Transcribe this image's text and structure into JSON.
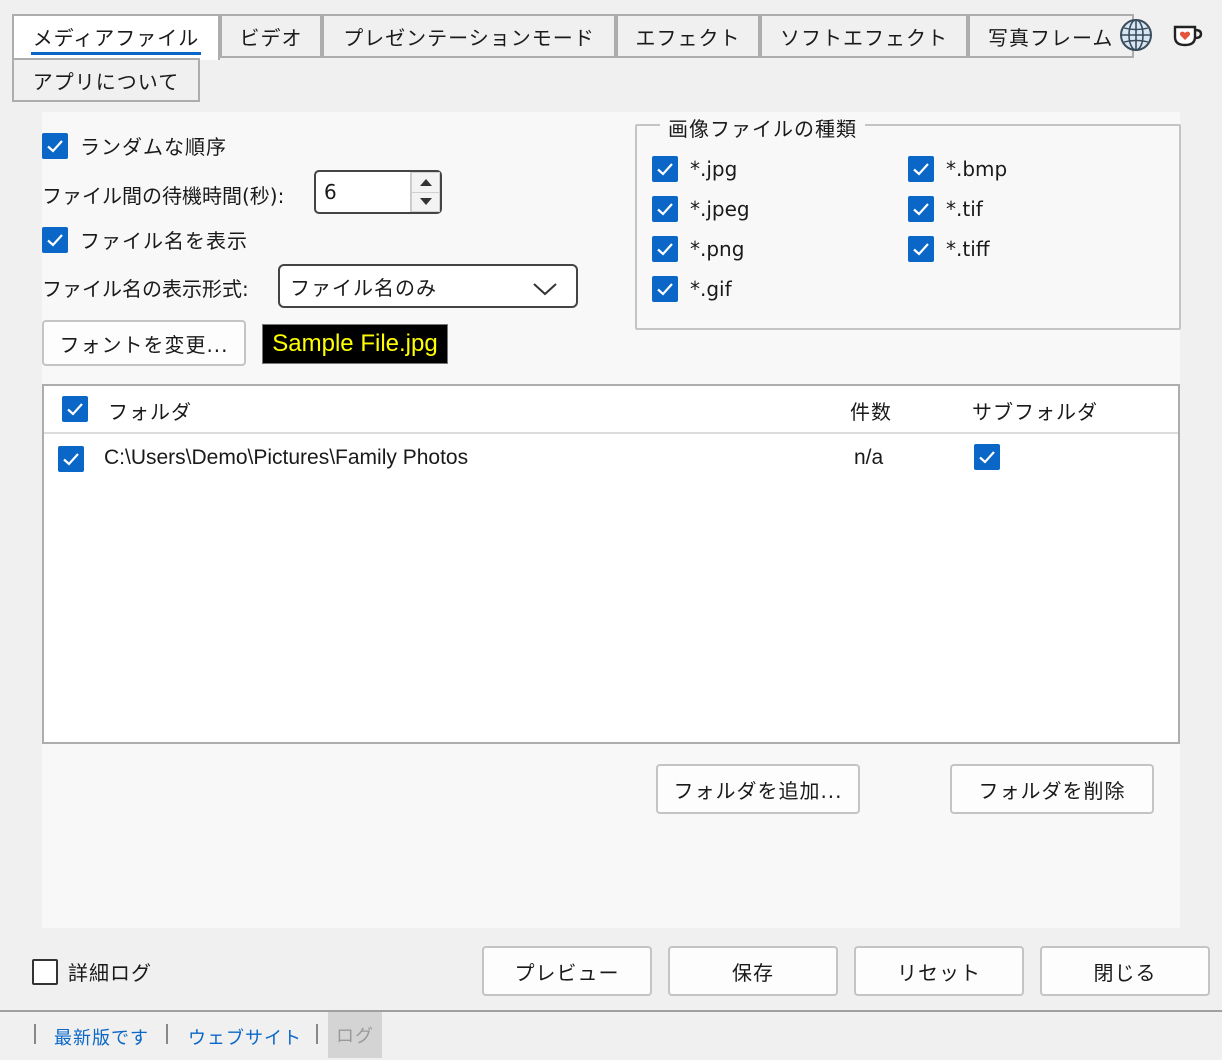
{
  "tabs": [
    {
      "label": "メディアファイル",
      "active": true
    },
    {
      "label": "ビデオ"
    },
    {
      "label": "プレゼンテーションモード"
    },
    {
      "label": "エフェクト"
    },
    {
      "label": "ソフトエフェクト"
    },
    {
      "label": "写真フレーム"
    },
    {
      "label": "アプリについて"
    }
  ],
  "options": {
    "random_order": {
      "label": "ランダムな順序",
      "checked": true
    },
    "wait_time": {
      "label": "ファイル間の待機時間(秒):",
      "value": "6"
    },
    "show_filename": {
      "label": "ファイル名を表示",
      "checked": true
    },
    "filename_format": {
      "label": "ファイル名の表示形式:",
      "value": "ファイル名のみ"
    },
    "change_font_button": "フォントを変更...",
    "sample_text": "Sample File.jpg"
  },
  "image_types": {
    "title": "画像ファイルの種類",
    "items": [
      {
        "label": "*.jpg",
        "checked": true
      },
      {
        "label": "*.bmp",
        "checked": true
      },
      {
        "label": "*.jpeg",
        "checked": true
      },
      {
        "label": "*.tif",
        "checked": true
      },
      {
        "label": "*.png",
        "checked": true
      },
      {
        "label": "*.tiff",
        "checked": true
      },
      {
        "label": "*.gif",
        "checked": true
      }
    ]
  },
  "folders": {
    "headers": {
      "folder": "フォルダ",
      "count": "件数",
      "subfolders": "サブフォルダ"
    },
    "rows": [
      {
        "path": "C:\\Users\\Demo\\Pictures\\Family Photos",
        "count": "n/a",
        "checked": true,
        "subfolders": true
      }
    ],
    "add_button": "フォルダを追加...",
    "remove_button": "フォルダを削除"
  },
  "footer": {
    "verbose_log": {
      "label": "詳細ログ",
      "checked": false
    },
    "preview": "プレビュー",
    "save": "保存",
    "reset": "リセット",
    "close": "閉じる"
  },
  "status": {
    "latest": "最新版です",
    "website": "ウェブサイト",
    "log": "ログ"
  },
  "colors": {
    "accent": "#0a67c7",
    "sample_bg": "#000000",
    "sample_fg": "#ffff00"
  },
  "icons": [
    "globe-icon",
    "coffee-heart-icon"
  ]
}
